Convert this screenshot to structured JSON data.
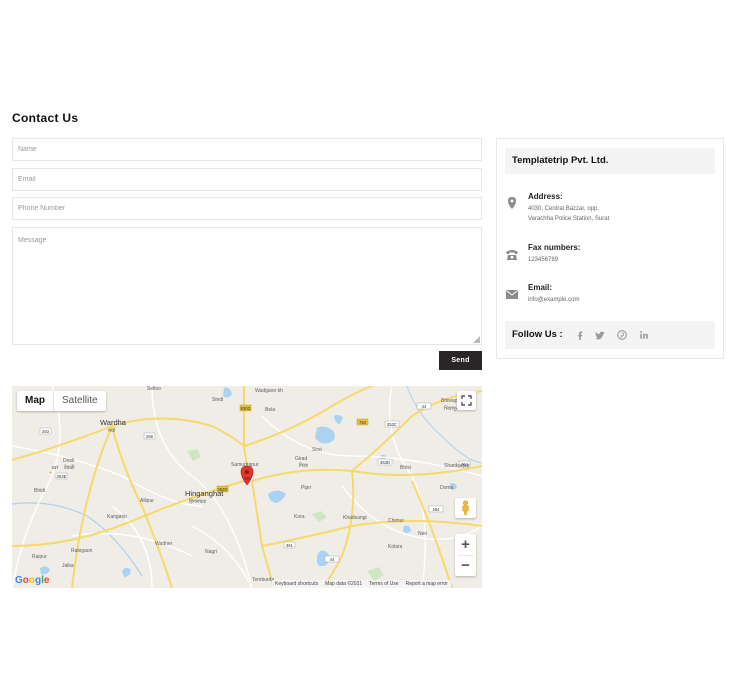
{
  "page": {
    "title": "Contact Us"
  },
  "form": {
    "name_placeholder": "Name",
    "email_placeholder": "Email",
    "phone_placeholder": "Phone Number",
    "message_placeholder": "Message",
    "send_label": "Send"
  },
  "map": {
    "type_map": "Map",
    "type_satellite": "Satellite",
    "zoom_in": "+",
    "zoom_out": "−",
    "google_letters": [
      "G",
      "o",
      "o",
      "g",
      "l",
      "e"
    ],
    "attribution": {
      "shortcuts": "Keyboard shortcuts",
      "data": "Map data ©2021",
      "terms": "Terms of Use",
      "report": "Report a map error"
    },
    "places": {
      "wardha": "Wardha",
      "wardha_local": "वर्धा",
      "hinganghat": "Hinganghat",
      "hinganghat_local": "हिंगणघाट",
      "selloo": "Selloo",
      "wadgaon": "Wadgaon kh",
      "sindi": "Sindi",
      "bela": "Bela",
      "girad": "Girad",
      "girad_local": "गिरड",
      "sirsi": "Sirsi",
      "bhiwapur": "Bhiwapur",
      "bhiwapur_local": "भिवापूर",
      "shankarpur": "Shankarpur",
      "bhisi": "Bhisi",
      "doma": "Doma",
      "deoli": "Deoli",
      "deoli_local": "देवळी",
      "bhidi": "Bhidi",
      "allipur": "Allipur",
      "kangaon": "Kangaon",
      "pipri": "Pipri",
      "kora": "Kora",
      "khadsangi": "Khadsangi",
      "chimur": "Chimur",
      "neri": "Neri",
      "kolara": "Kolara",
      "wadner": "Wadner",
      "nagri": "Nagri",
      "ralegaon": "Ralegaon",
      "jalka": "Jalka",
      "raipur": "Raipur",
      "samudrapur": "Samudrapur",
      "temburda": "Temburda"
    },
    "road_labels": [
      "263",
      "258",
      "44",
      "353C",
      "353D",
      "353E",
      "361",
      "361",
      "44",
      "264",
      "264",
      "930D",
      "353D",
      "753",
      "247"
    ]
  },
  "contact_card": {
    "company": "Templatetrip Pvt. Ltd.",
    "address_label": "Address:",
    "address_line1": "4030, Central Bazzar, opp.",
    "address_line2": "Varachha Police Station, Surat",
    "fax_label": "Fax numbers:",
    "fax_value": "123456789",
    "email_label": "Email:",
    "email_value": "info@example.com",
    "follow_label": "Follow Us :"
  },
  "icons": {
    "address": "location-pin-icon",
    "fax": "telephone-icon",
    "email": "envelope-icon",
    "social": [
      "facebook-icon",
      "twitter-icon",
      "pinterest-icon",
      "linkedin-icon"
    ]
  },
  "colors": {
    "button": "#2a2526",
    "map_land": "#f0ede6",
    "map_road": "#f7d96b",
    "map_water": "#a9d2f3",
    "map_pin": "#e2362b"
  }
}
